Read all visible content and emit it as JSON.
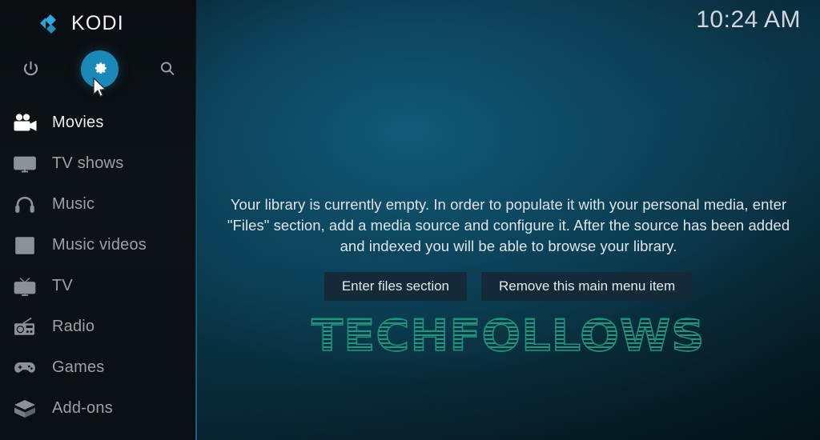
{
  "app": {
    "name": "KODI",
    "logo_icon": "kodi-logo-icon",
    "accent_color": "#1a89b8",
    "sidebar_bg": "#0b1115",
    "content_bg": "#0c3d52"
  },
  "header": {
    "clock": "10:24 AM"
  },
  "topbar": {
    "buttons": [
      {
        "name": "power-icon",
        "label": "Power",
        "active": false
      },
      {
        "name": "gear-icon",
        "label": "Settings",
        "active": true
      },
      {
        "name": "search-icon",
        "label": "Search",
        "active": false
      }
    ],
    "cursor_icon": "mouse-pointer-icon"
  },
  "sidebar": {
    "items": [
      {
        "label": "Movies",
        "icon": "movie-camera-icon",
        "selected": true
      },
      {
        "label": "TV shows",
        "icon": "monitor-icon",
        "selected": false
      },
      {
        "label": "Music",
        "icon": "headphones-icon",
        "selected": false
      },
      {
        "label": "Music videos",
        "icon": "film-note-icon",
        "selected": false
      },
      {
        "label": "TV",
        "icon": "television-icon",
        "selected": false
      },
      {
        "label": "Radio",
        "icon": "radio-icon",
        "selected": false
      },
      {
        "label": "Games",
        "icon": "gamepad-icon",
        "selected": false
      },
      {
        "label": "Add-ons",
        "icon": "addon-box-icon",
        "selected": false
      }
    ]
  },
  "main": {
    "empty_message": "Your library is currently empty. In order to populate it with your personal media, enter \"Files\" section, add a media source and configure it. After the source has been added and indexed you will be able to browse your library.",
    "buttons": [
      {
        "label": "Enter files section",
        "name": "enter-files-section-button"
      },
      {
        "label": "Remove this main menu item",
        "name": "remove-menu-item-button"
      }
    ],
    "watermark": "TECHFOLLOWS",
    "watermark_color": "#1f9b80"
  }
}
